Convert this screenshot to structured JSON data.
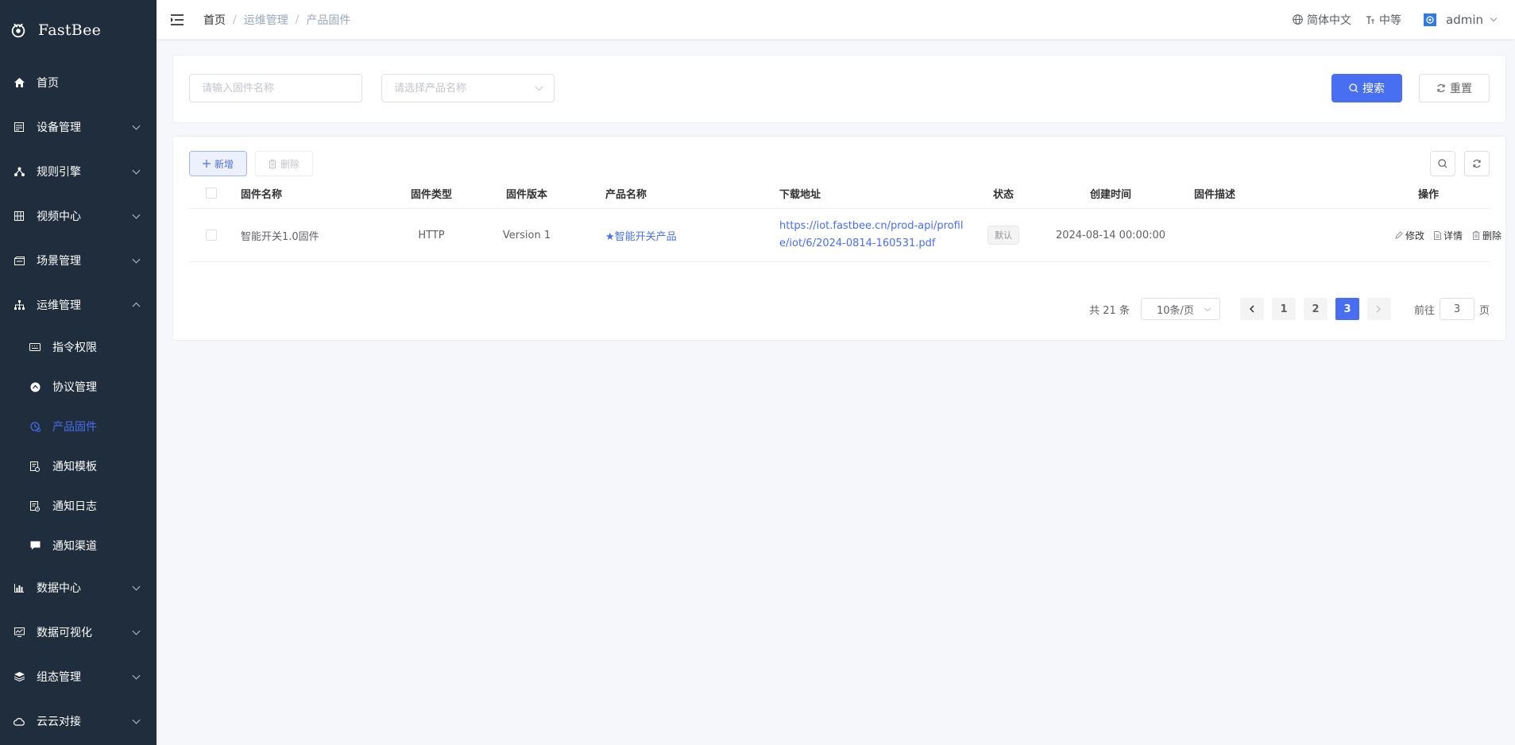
{
  "app": {
    "name": "FastBee"
  },
  "sidebar": {
    "items": [
      {
        "label": "首页",
        "icon": "home-icon"
      },
      {
        "label": "设备管理",
        "icon": "device-icon"
      },
      {
        "label": "规则引擎",
        "icon": "rule-engine-icon"
      },
      {
        "label": "视频中心",
        "icon": "video-icon"
      },
      {
        "label": "场景管理",
        "icon": "scene-icon"
      },
      {
        "label": "运维管理",
        "icon": "ops-icon",
        "expanded": true
      },
      {
        "label": "数据中心",
        "icon": "chart-icon"
      },
      {
        "label": "数据可视化",
        "icon": "monitor-icon"
      },
      {
        "label": "组态管理",
        "icon": "layers-icon"
      },
      {
        "label": "云云对接",
        "icon": "cloud-icon"
      }
    ],
    "sub_items": [
      {
        "label": "指令权限",
        "icon": "keyboard-icon"
      },
      {
        "label": "协议管理",
        "icon": "protocol-icon"
      },
      {
        "label": "产品固件",
        "icon": "firmware-icon",
        "active": true
      },
      {
        "label": "通知模板",
        "icon": "template-icon"
      },
      {
        "label": "通知日志",
        "icon": "log-icon"
      },
      {
        "label": "通知渠道",
        "icon": "message-icon"
      }
    ],
    "active_color": "#486ff2"
  },
  "header": {
    "breadcrumb": [
      "首页",
      "运维管理",
      "产品固件"
    ],
    "language": "简体中文",
    "size": "中等",
    "user": "admin"
  },
  "search": {
    "firmware_placeholder": "请输入固件名称",
    "product_placeholder": "请选择产品名称",
    "search_label": "搜索",
    "reset_label": "重置"
  },
  "toolbar": {
    "add_label": "新增",
    "delete_label": "删除"
  },
  "table": {
    "columns": [
      "固件名称",
      "固件类型",
      "固件版本",
      "产品名称",
      "下载地址",
      "状态",
      "创建时间",
      "固件描述",
      "操作"
    ],
    "rows": [
      {
        "name": "智能开关1.0固件",
        "type": "HTTP",
        "version": "Version 1",
        "product": "★智能开关产品",
        "url": "https://iot.fastbee.cn/prod-api/profile/iot/6/2024-0814-160531.pdf",
        "status": "默认",
        "created": "2024-08-14 00:00:00",
        "description": "",
        "actions": {
          "edit": "修改",
          "detail": "详情",
          "delete": "删除"
        }
      }
    ]
  },
  "pagination": {
    "total": "共 21 条",
    "page_size": "10条/页",
    "pages": [
      "1",
      "2",
      "3"
    ],
    "current": "3",
    "goto_prefix": "前往",
    "goto_value": "3",
    "goto_suffix": "页"
  },
  "colors": {
    "primary": "#486ff2",
    "sidebar_bg": "#1f2d3d"
  }
}
